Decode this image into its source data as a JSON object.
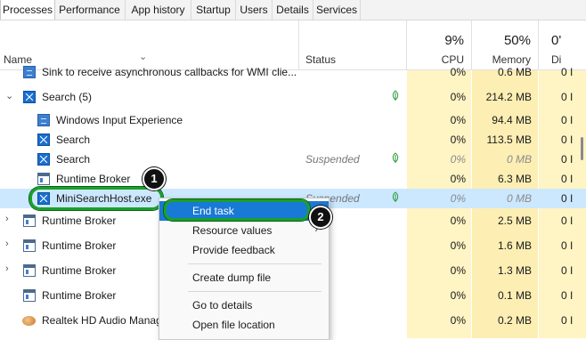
{
  "tabs": [
    {
      "label": "Processes",
      "active": true
    },
    {
      "label": "Performance"
    },
    {
      "label": "App history"
    },
    {
      "label": "Startup"
    },
    {
      "label": "Users"
    },
    {
      "label": "Details"
    },
    {
      "label": "Services"
    }
  ],
  "columns": {
    "name": "Name",
    "status": "Status",
    "cpu": {
      "pct": "9%",
      "label": "CPU"
    },
    "memory": {
      "pct": "50%",
      "label": "Memory"
    },
    "disk": {
      "pct": "0'",
      "label": "Di"
    }
  },
  "rows": [
    {
      "name": "Sink to receive asynchronous callbacks for WMI clie...",
      "icon": "app-window-icon",
      "cpu": "0%",
      "mem": "0.6 MB",
      "disk": "0 I"
    },
    {
      "name": "Search (5)",
      "icon": "search-app-icon",
      "expanded": true,
      "leaf": true,
      "cpu": "0%",
      "mem": "214.2 MB",
      "disk": "0 I"
    },
    {
      "name": "Windows Input Experience",
      "icon": "window-icon",
      "cpu": "0%",
      "mem": "94.4 MB",
      "disk": "0 I"
    },
    {
      "name": "Search",
      "icon": "search-app-icon",
      "cpu": "0%",
      "mem": "113.5 MB",
      "disk": "0 I"
    },
    {
      "name": "Search",
      "icon": "search-app-icon",
      "status": "Suspended",
      "leaf": true,
      "cpu": "0%",
      "mem": "0 MB",
      "disk": "0 I"
    },
    {
      "name": "Runtime Broker",
      "icon": "runtime-broker-icon",
      "cpu": "0%",
      "mem": "6.3 MB",
      "disk": "0 I"
    },
    {
      "name": "MiniSearchHost.exe",
      "icon": "search-app-icon",
      "status": "Suspended",
      "leaf": true,
      "selected": true,
      "cpu": "0%",
      "mem": "0 MB",
      "disk": "0 I"
    },
    {
      "name": "Runtime Broker",
      "icon": "runtime-broker-icon",
      "collapsed": true,
      "cpu": "0%",
      "mem": "2.5 MB",
      "disk": "0 I"
    },
    {
      "name": "Runtime Broker",
      "icon": "runtime-broker-icon",
      "collapsed": true,
      "cpu": "0%",
      "mem": "1.6 MB",
      "disk": "0 I"
    },
    {
      "name": "Runtime Broker",
      "icon": "runtime-broker-icon",
      "collapsed": true,
      "cpu": "0%",
      "mem": "1.3 MB",
      "disk": "0 I"
    },
    {
      "name": "Runtime Broker",
      "icon": "runtime-broker-icon",
      "cpu": "0%",
      "mem": "0.1 MB",
      "disk": "0 I"
    },
    {
      "name": "Realtek HD Audio Manag",
      "icon": "audio-icon",
      "cpu": "0%",
      "mem": "0.2 MB",
      "disk": "0 I"
    }
  ],
  "context_menu": {
    "items": [
      {
        "label": "End task",
        "highlighted": true
      },
      {
        "label": "Resource values",
        "submenu": true
      },
      {
        "label": "Provide feedback"
      },
      {
        "label": "Create dump file"
      },
      {
        "label": "Go to details"
      },
      {
        "label": "Open file location"
      }
    ]
  },
  "callouts": [
    "1",
    "2"
  ],
  "colors": {
    "accent": "#1979d6",
    "selection": "#cce8ff",
    "heat_cpu": "#fff4c4",
    "heat_mem": "#fde8a8",
    "highlight_ring": "#1aa12b"
  }
}
